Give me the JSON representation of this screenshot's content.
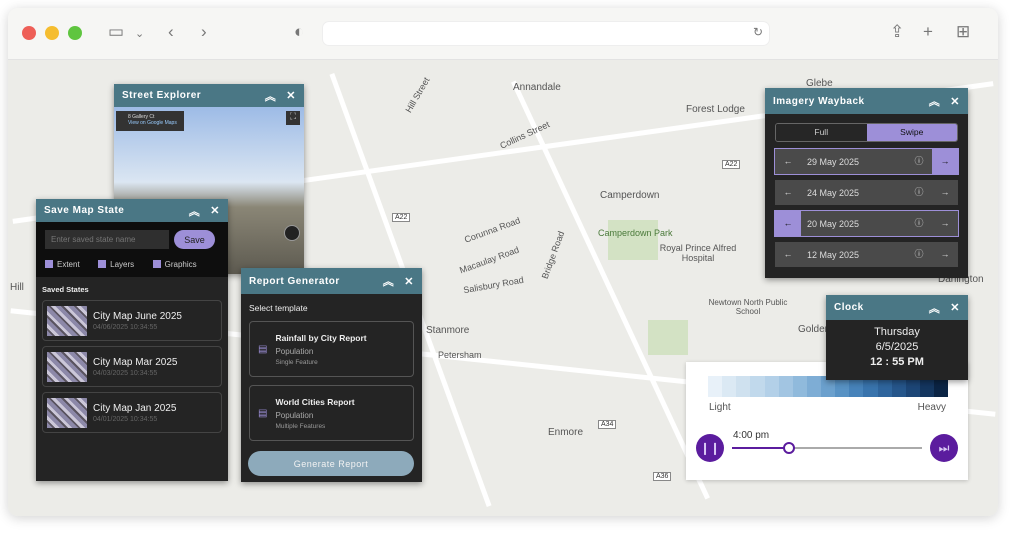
{
  "map": {
    "labels": [
      "Annandale",
      "Glebe",
      "Forest Lodge",
      "Camperdown",
      "Camperdown Park",
      "Royal Prince Alfred Hospital",
      "Newtown North Public School",
      "Enmore",
      "Darlington",
      "Golden",
      "Corunna Road",
      "Salisbury Road",
      "Macaulay Road",
      "Collins Street",
      "Stanmore",
      "Hill",
      "Hill Street",
      "Petersham",
      "Bridge Road"
    ],
    "shields": [
      "A22",
      "A22",
      "A36",
      "A34"
    ]
  },
  "street": {
    "title": "Street Explorer",
    "address": "8 Gallery Ct",
    "view": "View on Google Maps"
  },
  "save": {
    "title": "Save Map State",
    "placeholder": "Enter saved state name",
    "save": "Save",
    "checks": [
      "Extent",
      "Layers",
      "Graphics"
    ],
    "section": "Saved States",
    "states": [
      {
        "name": "City Map June 2025",
        "date": "04/06/2025  10:34:55"
      },
      {
        "name": "City Map Mar 2025",
        "date": "04/03/2025  10:34:55"
      },
      {
        "name": "City Map Jan 2025",
        "date": "04/01/2025  10:34:55"
      }
    ]
  },
  "report": {
    "title": "Report Generator",
    "select": "Select template",
    "templates": [
      {
        "name": "Rainfall by City Report",
        "field": "Population",
        "type": "Single Feature"
      },
      {
        "name": "World Cities Report",
        "field": "Population",
        "type": "Multiple Features"
      }
    ],
    "button": "Generate Report"
  },
  "wayback": {
    "title": "Imagery Wayback",
    "modes": [
      "Full",
      "Swipe"
    ],
    "dates": [
      "29 May 2025",
      "24 May 2025",
      "20 May 2025",
      "12 May 2025"
    ]
  },
  "clock": {
    "title": "Clock",
    "day": "Thursday",
    "date": "6/5/2025",
    "time": "12 : 55 PM"
  },
  "legend": {
    "low": "Light",
    "high": "Heavy",
    "time": "4:00 pm",
    "progress": 0.3,
    "colors": [
      "#e8f1f9",
      "#dbe9f4",
      "#cfe1ef",
      "#c1d9ec",
      "#b3d0e8",
      "#a2c5e2",
      "#90badc",
      "#7eadd5",
      "#6ba0cd",
      "#5892c4",
      "#4783ba",
      "#3974ad",
      "#2f659d",
      "#26568b",
      "#1d4677",
      "#14365f",
      "#0b2444"
    ]
  }
}
